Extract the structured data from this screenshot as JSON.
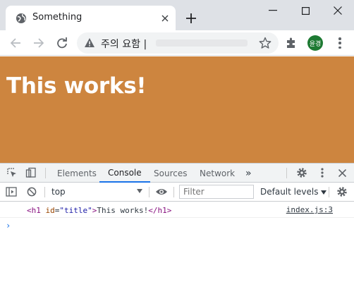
{
  "window": {
    "tab_title": "Something",
    "new_tab_icon": "plus-icon",
    "controls": [
      "minimize-icon",
      "maximize-icon",
      "close-icon"
    ]
  },
  "toolbar": {
    "omnibox_warning": "주의 요함",
    "omnibox_separator": "|",
    "avatar_label": "윤경"
  },
  "page": {
    "heading": "This works!",
    "background_color": "#cd853f"
  },
  "devtools": {
    "tabs": [
      "Elements",
      "Console",
      "Sources",
      "Network"
    ],
    "active_tab": "Console",
    "more_tabs": "»",
    "context": "top",
    "filter_placeholder": "Filter",
    "levels": "Default levels",
    "log": {
      "tag_open": "<h1",
      "attr_name": "id",
      "attr_eq": "=",
      "attr_value": "\"title\"",
      "tag_close_bracket": ">",
      "text": "This works!",
      "tag_end": "</h1>",
      "source": "index.js:3"
    },
    "prompt": "›"
  },
  "colors": {
    "accent": "#1a73e8",
    "tabstrip": "#dee1e6"
  }
}
